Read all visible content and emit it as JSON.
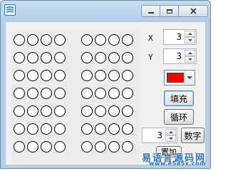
{
  "x_field": {
    "label": "X",
    "value": "3"
  },
  "y_field": {
    "label": "Y",
    "value": "3"
  },
  "color_picker": {
    "selected_color": "#ff0000"
  },
  "buttons": {
    "fill_label": "填充",
    "cycle_label": "循环",
    "number_label": "数字",
    "bottom_label": "置加"
  },
  "number_field": {
    "value": "3"
  },
  "watermark": {
    "text": "易语言源码网",
    "url": "www.e5a5x.com"
  },
  "colors": {
    "accent": "#2c73c2",
    "title_bg": "#c7dcef",
    "client_bg": "#f0f0f0"
  }
}
